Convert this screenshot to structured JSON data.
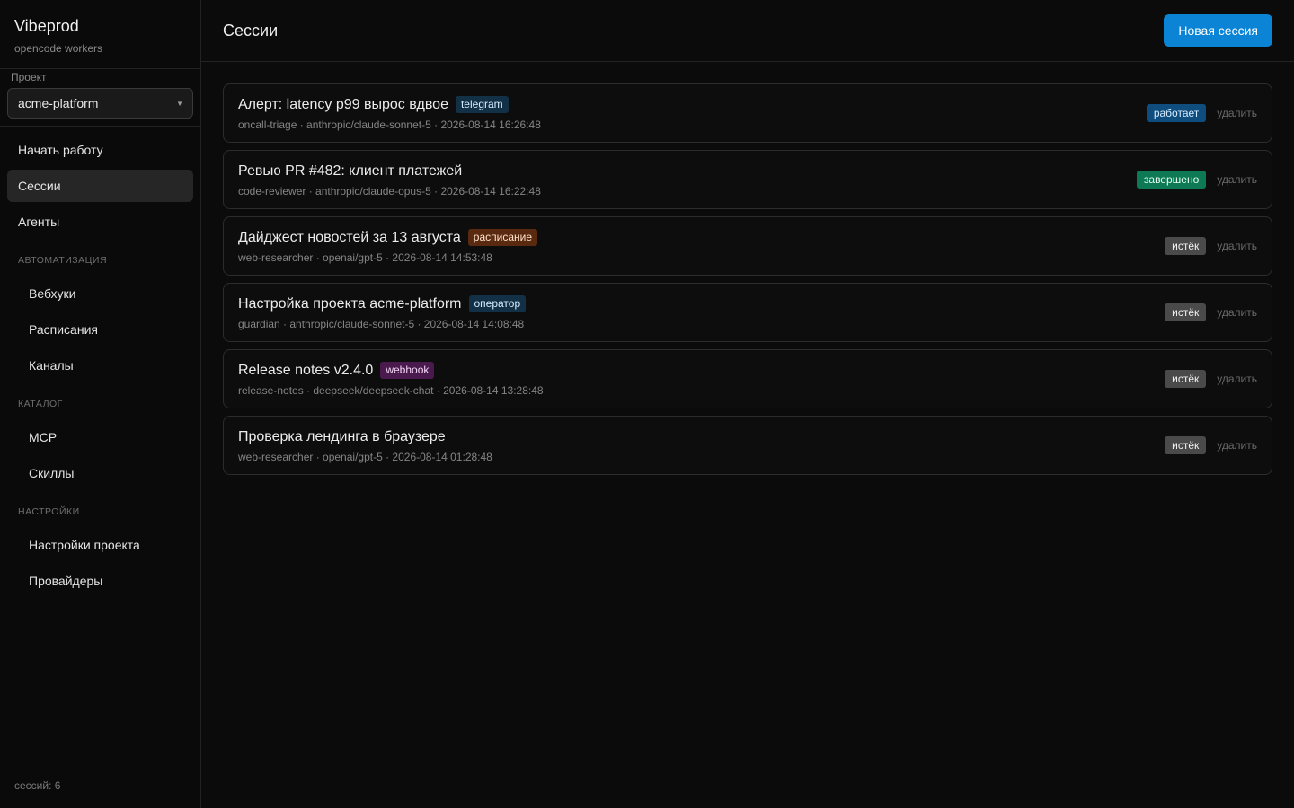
{
  "app": {
    "title": "Vibeprod",
    "subtitle": "opencode workers"
  },
  "project": {
    "label": "Проект",
    "selected": "acme-platform"
  },
  "nav": {
    "start": "Начать работу",
    "sessions": "Сессии",
    "agents": "Агенты",
    "section_automation": "Автоматизация",
    "webhooks": "Вебхуки",
    "schedules": "Расписания",
    "channels": "Каналы",
    "section_catalog": "Каталог",
    "mcp": "MCP",
    "skills": "Скиллы",
    "section_settings": "Настройки",
    "project_settings": "Настройки проекта",
    "providers": "Провайдеры"
  },
  "footer": {
    "sessions_count": "сессий: 6"
  },
  "header": {
    "title": "Сессии",
    "new_session": "Новая сессия"
  },
  "delete_label": "удалить",
  "colors": {
    "accent": "#0b84d6",
    "tag_telegram_bg": "#123046",
    "tag_telegram_fg": "#d6ecff",
    "tag_schedule_bg": "#5a2a10",
    "tag_schedule_fg": "#ffe1cc",
    "tag_operator_bg": "#123046",
    "tag_operator_fg": "#d6ecff",
    "tag_webhook_bg": "#4a1a4e",
    "tag_webhook_fg": "#f3d6f5",
    "status_running_bg": "#0e4d7d",
    "status_running_fg": "#d6ecff",
    "status_done_bg": "#0d7a55",
    "status_done_fg": "#e4fff2",
    "status_expired_bg": "#4a4a4a",
    "status_expired_fg": "#f0f0f0"
  },
  "sessions": [
    {
      "title": "Алерт: latency p99 вырос вдвое",
      "tag": "telegram",
      "tag_kind": "telegram",
      "meta": "oncall-triage · anthropic/claude-sonnet-5 · 2026-08-14 16:26:48",
      "status": "работает",
      "status_kind": "running"
    },
    {
      "title": "Ревью PR #482: клиент платежей",
      "tag": "",
      "tag_kind": "",
      "meta": "code-reviewer · anthropic/claude-opus-5 · 2026-08-14 16:22:48",
      "status": "завершено",
      "status_kind": "done"
    },
    {
      "title": "Дайджест новостей за 13 августа",
      "tag": "расписание",
      "tag_kind": "schedule",
      "meta": "web-researcher · openai/gpt-5 · 2026-08-14 14:53:48",
      "status": "истёк",
      "status_kind": "expired"
    },
    {
      "title": "Настройка проекта acme-platform",
      "tag": "оператор",
      "tag_kind": "operator",
      "meta": "guardian · anthropic/claude-sonnet-5 · 2026-08-14 14:08:48",
      "status": "истёк",
      "status_kind": "expired"
    },
    {
      "title": "Release notes v2.4.0",
      "tag": "webhook",
      "tag_kind": "webhook",
      "meta": "release-notes · deepseek/deepseek-chat · 2026-08-14 13:28:48",
      "status": "истёк",
      "status_kind": "expired"
    },
    {
      "title": "Проверка лендинга в браузере",
      "tag": "",
      "tag_kind": "",
      "meta": "web-researcher · openai/gpt-5 · 2026-08-14 01:28:48",
      "status": "истёк",
      "status_kind": "expired"
    }
  ]
}
